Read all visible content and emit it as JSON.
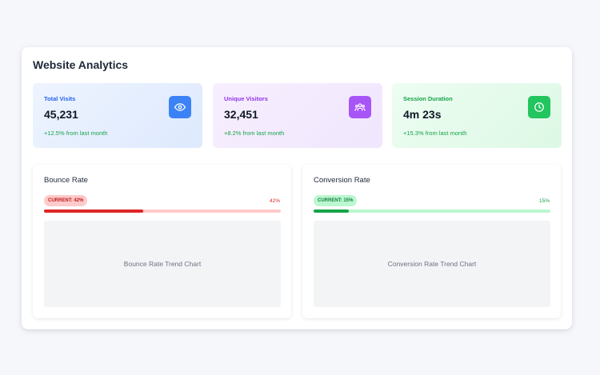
{
  "page": {
    "title": "Website Analytics"
  },
  "stats": [
    {
      "label": "Total Visits",
      "value": "45,231",
      "change": "+12.5% from last month",
      "icon": "eye-icon",
      "accent": "#3b82f6"
    },
    {
      "label": "Unique Visitors",
      "value": "32,451",
      "change": "+8.2% from last month",
      "icon": "users-icon",
      "accent": "#a855f7"
    },
    {
      "label": "Session Duration",
      "value": "4m 23s",
      "change": "+15.3% from last month",
      "icon": "clock-icon",
      "accent": "#22c55e"
    }
  ],
  "bounce": {
    "title": "Bounce Rate",
    "badge": "CURRENT: 42%",
    "percent_label": "42%",
    "progress": 0.42,
    "chart_placeholder": "Bounce Rate Trend Chart",
    "color": "#dc2626"
  },
  "conversion": {
    "title": "Conversion Rate",
    "badge": "CURRENT: 15%",
    "percent_label": "15%",
    "progress": 0.15,
    "chart_placeholder": "Conversion Rate Trend Chart",
    "color": "#16a34a"
  }
}
